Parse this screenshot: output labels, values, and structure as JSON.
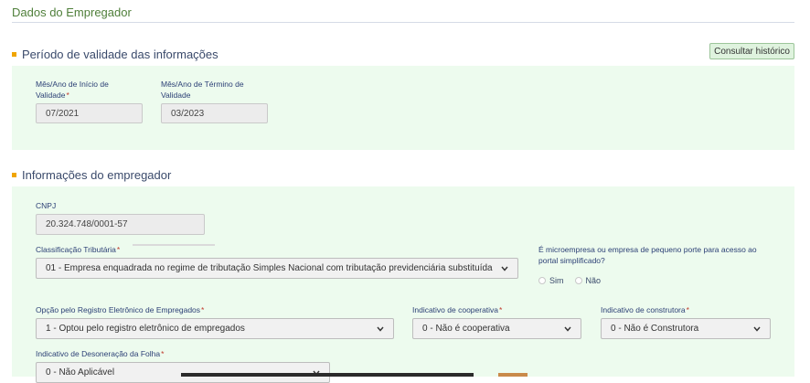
{
  "page": {
    "title": "Dados do Empregador"
  },
  "validity": {
    "header": "Período de validade das informações",
    "history_button": "Consultar histórico",
    "start": {
      "label_line1": "Mês/Ano de Início de",
      "label_line2": "Validade",
      "value": "07/2021"
    },
    "end": {
      "label_line1": "Mês/Ano de Término de",
      "label_line2": "Validade",
      "value": "03/2023"
    }
  },
  "employer": {
    "header": "Informações do empregador",
    "cnpj": {
      "label": "CNPJ",
      "value": "20.324.748/0001-57"
    },
    "tax_class": {
      "label": "Classificação Tributária",
      "value": "01 - Empresa enquadrada no regime de tributação Simples Nacional com tributação previdenciária substituída"
    },
    "micro": {
      "label_line1": "É microempresa ou empresa de pequeno porte para acesso ao",
      "label_line2": "portal simplificado?",
      "yes": "Sim",
      "no": "Não",
      "selected": "Não"
    },
    "electronic_registry": {
      "label": "Opção pelo Registro Eletrônico de Empregados",
      "value": "1 - Optou pelo registro eletrônico de empregados"
    },
    "cooperative": {
      "label": "Indicativo de cooperativa",
      "value": "0 - Não é cooperativa"
    },
    "construction": {
      "label": "Indicativo de construtora",
      "value": "0 - Não é Construtora"
    },
    "payroll": {
      "label": "Indicativo de Desoneração da Folha",
      "value": "0 - Não Aplicável"
    }
  },
  "colors": {
    "accent": "#f0a500",
    "panel": "#edfbee",
    "title": "#4f7f3a",
    "label": "#2b3f75",
    "required": "#c0392b"
  }
}
